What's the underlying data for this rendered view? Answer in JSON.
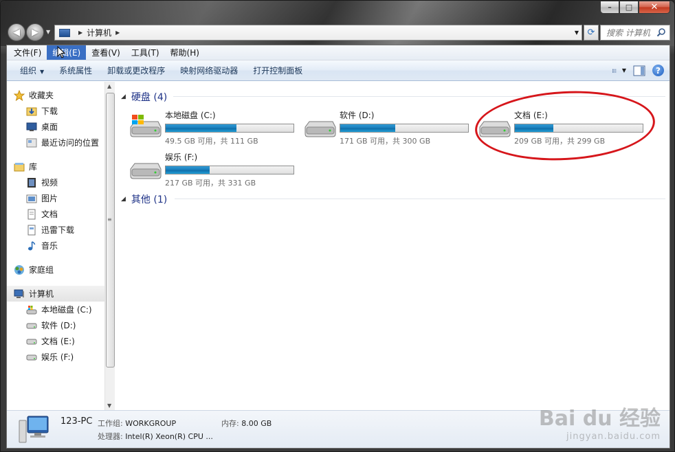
{
  "window": {
    "caption": {
      "minimize": "–",
      "maximize": "□",
      "close": "✕"
    }
  },
  "address": {
    "path": [
      "计算机"
    ],
    "search_placeholder": "搜索 计算机"
  },
  "menubar": {
    "items": [
      "文件(F)",
      "编辑(E)",
      "查看(V)",
      "工具(T)",
      "帮助(H)"
    ],
    "active_index": 1
  },
  "cmdbar": {
    "organize": "组织",
    "items": [
      "系统属性",
      "卸载或更改程序",
      "映射网络驱动器",
      "打开控制面板"
    ]
  },
  "navpane": {
    "favorites": {
      "label": "收藏夹",
      "items": [
        "下载",
        "桌面",
        "最近访问的位置"
      ]
    },
    "libraries": {
      "label": "库",
      "items": [
        "视频",
        "图片",
        "文档",
        "迅雷下载",
        "音乐"
      ]
    },
    "homegroup": {
      "label": "家庭组"
    },
    "computer": {
      "label": "计算机",
      "drives": [
        "本地磁盘 (C:)",
        "软件 (D:)",
        "文档 (E:)",
        "娱乐 (F:)"
      ]
    }
  },
  "content": {
    "hdd_group": "硬盘 (4)",
    "other_group": "其他 (1)",
    "drives": [
      {
        "name": "本地磁盘 (C:)",
        "space": "49.5 GB 可用，共 111 GB",
        "used_fraction": 0.554,
        "system": true
      },
      {
        "name": "软件 (D:)",
        "space": "171 GB 可用，共 300 GB",
        "used_fraction": 0.43,
        "system": false
      },
      {
        "name": "文档 (E:)",
        "space": "209 GB 可用，共 299 GB",
        "used_fraction": 0.301,
        "system": false
      },
      {
        "name": "娱乐 (F:)",
        "space": "217 GB 可用，共 331 GB",
        "used_fraction": 0.344,
        "system": false
      }
    ]
  },
  "details": {
    "pc_name": "123-PC",
    "workgroup_label": "工作组:",
    "workgroup": "WORKGROUP",
    "memory_label": "内存:",
    "memory": "8.00 GB",
    "cpu_label": "处理器:",
    "cpu": "Intel(R) Xeon(R) CPU ..."
  },
  "watermark": {
    "main": "Bai du 经验",
    "sub": "jingyan.baidu.com"
  },
  "colors": {
    "accent": "#3a6fc4",
    "bar_fill": "#1a7dba",
    "annotation": "#d6161b",
    "group_head": "#1e3287"
  }
}
